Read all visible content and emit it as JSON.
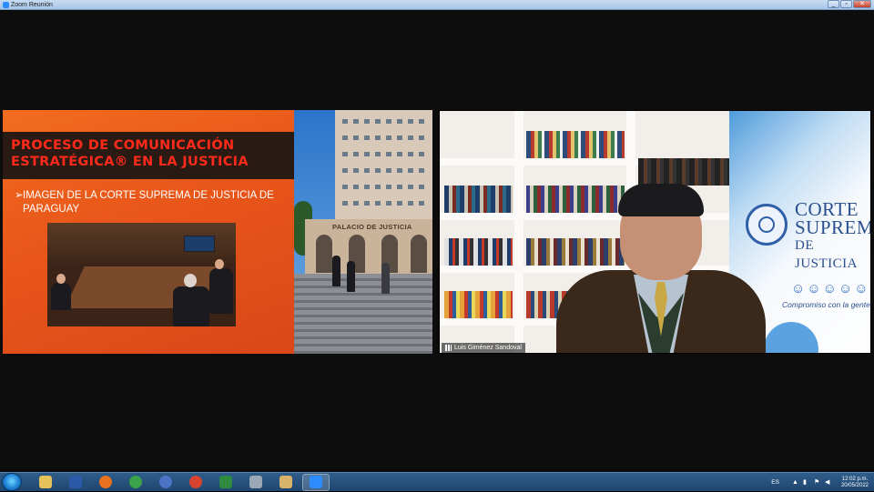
{
  "window": {
    "title": "Zoom Reunión",
    "controls": {
      "minimize": "_",
      "maximize": "▫",
      "close": "✕"
    }
  },
  "slide": {
    "title": "PROCESO DE COMUNICACIÓN ESTRATÉGICA® EN LA JUSTICIA",
    "bullet_marker": "➢",
    "bullet": "IMAGEN DE LA CORTE SUPREMA DE JUSTICIA DE PARAGUAY",
    "building_sign": "PALACIO DE JUSTICIA"
  },
  "speaker": {
    "name": "Luis Giménez Sandoval",
    "banner": {
      "line1": "CORTE",
      "line2": "SUPREMA",
      "line3": "DE JUSTICIA",
      "figures": "☺☺☺☺☺",
      "tagline": "Compromiso con la gente"
    }
  },
  "taskbar": {
    "apps": [
      {
        "name": "file-explorer",
        "color": "#e6c35a"
      },
      {
        "name": "word",
        "color": "#2b5aa8"
      },
      {
        "name": "firefox",
        "color": "#e8711f"
      },
      {
        "name": "chrome",
        "color": "#3aa24a"
      },
      {
        "name": "people",
        "color": "#4b74c6"
      },
      {
        "name": "chrome",
        "color": "#d8432f"
      },
      {
        "name": "excel",
        "color": "#2d8a3e"
      },
      {
        "name": "calculator",
        "color": "#9aa8b6"
      },
      {
        "name": "paint",
        "color": "#d9b36a"
      },
      {
        "name": "zoom",
        "color": "#2d8cff"
      }
    ],
    "tray": {
      "language": "ES",
      "time": "12:02 p.m.",
      "date": "20/05/2022"
    }
  }
}
